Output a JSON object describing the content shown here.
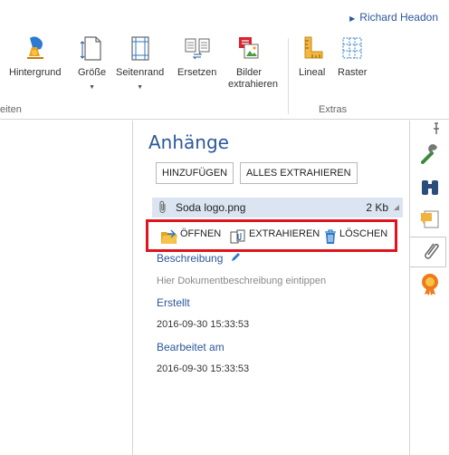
{
  "user": {
    "name": "Richard Headon"
  },
  "ribbon": {
    "buttons": [
      {
        "label": "Hintergrund",
        "has_dropdown": false
      },
      {
        "label": "Größe",
        "has_dropdown": true
      },
      {
        "label": "Seitenrand",
        "has_dropdown": true
      },
      {
        "label": "Ersetzen",
        "has_dropdown": false
      },
      {
        "label": "Bilder extrahieren",
        "has_dropdown": false
      },
      {
        "label": "Lineal",
        "has_dropdown": false
      },
      {
        "label": "Raster",
        "has_dropdown": false
      }
    ],
    "groups": {
      "left_partial": "eiten",
      "extras": "Extras"
    }
  },
  "panel": {
    "title": "Anhänge",
    "add_button": "HINZUFÜGEN",
    "extract_all_button": "ALLES EXTRAHIEREN",
    "attachment": {
      "name": "Soda logo.png",
      "size": "2 Kb"
    },
    "actions": {
      "open": "ÖFFNEN",
      "extract": "EXTRAHIEREN",
      "delete": "LÖSCHEN"
    },
    "description_label": "Beschreibung",
    "description_placeholder": "Hier Dokumentbeschreibung eintippen",
    "created_label": "Erstellt",
    "created_value": "2016-09-30 15:33:53",
    "modified_label": "Bearbeitet am",
    "modified_value": "2016-09-30 15:33:53"
  },
  "colors": {
    "accent": "#2b579a",
    "highlight": "#e0141e",
    "selected_row": "#dbe5f2"
  },
  "rail_icons": [
    "pin-icon",
    "wrench-icon",
    "binoculars-icon",
    "comment-icon",
    "paperclip-icon",
    "certificate-icon"
  ]
}
